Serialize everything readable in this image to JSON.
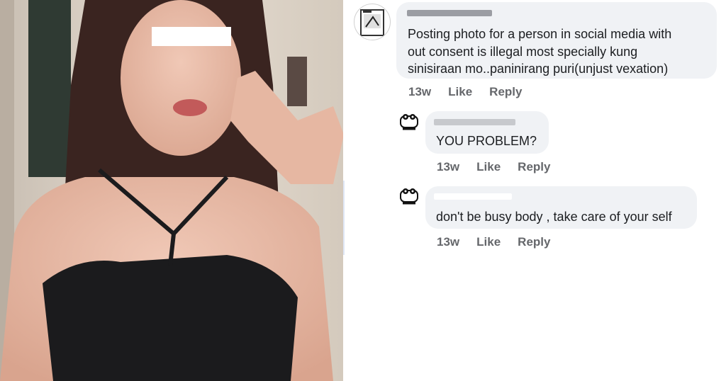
{
  "comments": [
    {
      "text": "Posting photo for a  person in social media with\nout consent is illegal most specially kung\nsinisiraan mo..paninirang puri(unjust vexation)",
      "time": "13w",
      "like_label": "Like",
      "reply_label": "Reply"
    },
    {
      "text": "YOU PROBLEM?",
      "time": "13w",
      "like_label": "Like",
      "reply_label": "Reply"
    },
    {
      "text": "don't be busy body , take care of your self",
      "time": "13w",
      "like_label": "Like",
      "reply_label": "Reply"
    }
  ],
  "colors": {
    "bubble": "#f0f2f5",
    "action_text": "#65676b",
    "comment_text": "#1c1e21"
  }
}
